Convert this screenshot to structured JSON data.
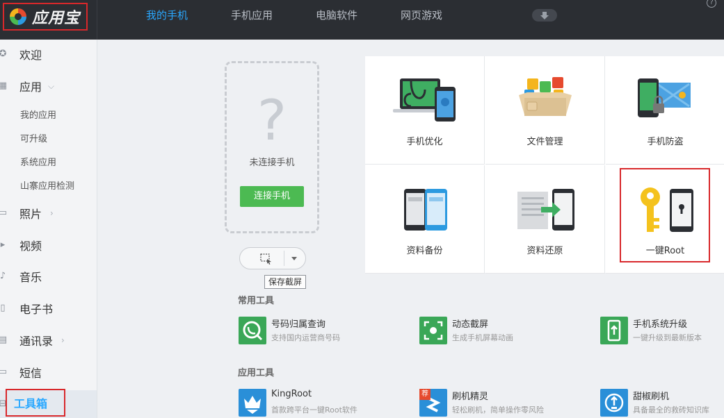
{
  "app": {
    "title": "应用宝"
  },
  "nav": {
    "items": [
      {
        "label": "我的手机",
        "active": true
      },
      {
        "label": "手机应用"
      },
      {
        "label": "电脑软件"
      },
      {
        "label": "网页游戏"
      }
    ]
  },
  "help": "?",
  "sidebar": {
    "welcome": "欢迎",
    "apps": "应用",
    "sub": [
      "我的应用",
      "可升级",
      "系统应用",
      "山寨应用检测"
    ],
    "photos": "照片",
    "video": "视频",
    "music": "音乐",
    "ebook": "电子书",
    "contacts": "通讯录",
    "sms": "短信",
    "toolbox": "工具箱"
  },
  "phone": {
    "question": "?",
    "status": "未连接手机",
    "connect": "连接手机"
  },
  "screenshot": {
    "tooltip": "保存截屏"
  },
  "grid": [
    {
      "label": "手机优化",
      "icon": "phone-optimize-icon"
    },
    {
      "label": "文件管理",
      "icon": "file-manage-icon"
    },
    {
      "label": "手机防盗",
      "icon": "anti-theft-icon"
    },
    {
      "label": "资料备份",
      "icon": "backup-icon"
    },
    {
      "label": "资料还原",
      "icon": "restore-icon"
    },
    {
      "label": "一键Root",
      "icon": "root-key-icon"
    }
  ],
  "sections": {
    "common": "常用工具",
    "apps": "应用工具"
  },
  "common_tools": [
    {
      "name": "号码归属查询",
      "desc": "支持国内运营商号码",
      "color": "#3aa757"
    },
    {
      "name": "动态截屏",
      "desc": "生成手机屏幕动画",
      "color": "#3aa757"
    },
    {
      "name": "手机系统升级",
      "desc": "一键升级到最新版本",
      "color": "#3aa757"
    }
  ],
  "app_tools": [
    {
      "name": "KingRoot",
      "desc": "首款跨平台一键Root软件",
      "color": "#2a8fd8"
    },
    {
      "name": "刷机精灵",
      "desc": "轻松刷机，简单操作零风险",
      "color": "#2a8fd8",
      "badge": "荐"
    },
    {
      "name": "甜椒刷机",
      "desc": "具备最全的救砖知识库",
      "color": "#2a8fd8"
    }
  ],
  "colors": {
    "accent": "#2aa8ff",
    "green": "#4cba52",
    "highlight": "#d8282b",
    "topbar": "#2b2e33"
  }
}
